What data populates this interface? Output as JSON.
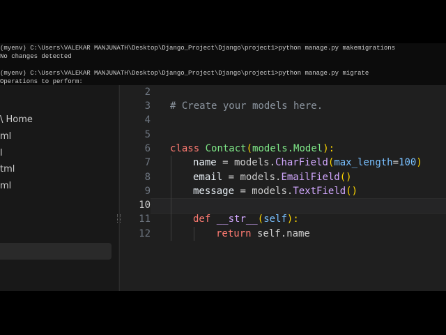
{
  "terminal": {
    "lines": [
      "(myenv) C:\\Users\\VALEKAR MANJUNATH\\Desktop\\Django_Project\\Django\\project1>python manage.py makemigrations",
      "No changes detected",
      "",
      "(myenv) C:\\Users\\VALEKAR MANJUNATH\\Desktop\\Django_Project\\Django\\project1>python manage.py migrate",
      "Operations to perform:"
    ]
  },
  "sidebar": {
    "items": [
      "\\ Home",
      "ml",
      "l",
      "tml",
      "ml"
    ]
  },
  "editor": {
    "line_numbers": [
      "2",
      "3",
      "4",
      "5",
      "6",
      "7",
      "8",
      "9",
      "10",
      "11",
      "12"
    ],
    "active_line": "10",
    "code": {
      "l3_comment": "# Create your models here.",
      "l6_class": "class",
      "l6_name": "Contact",
      "l6_p1": "(",
      "l6_base": "models.Model",
      "l6_p2": "):",
      "l7_var": "name",
      "l7_eq": " = models.",
      "l7_fn": "CharField",
      "l7_p1": "(",
      "l7_arg": "max_length",
      "l7_eq2": "=",
      "l7_num": "100",
      "l7_p2": ")",
      "l8_var": "email",
      "l8_eq": " = models.",
      "l8_fn": "EmailField",
      "l8_par": "()",
      "l9_var": "message",
      "l9_eq": " = models.",
      "l9_fn": "TextField",
      "l9_par": "()",
      "l11_def": "def",
      "l11_fn": "__str__",
      "l11_p1": "(",
      "l11_self": "self",
      "l11_p2": "):",
      "l12_ret": "return",
      "l12_rest": " self.name"
    }
  },
  "colors": {
    "background": "#1f1f1f",
    "sidebar": "#181818",
    "terminal": "#0c0c0c",
    "keyword": "#ff7b72",
    "class_name": "#7ee787",
    "function": "#d2a8ff",
    "number": "#79c0ff"
  }
}
